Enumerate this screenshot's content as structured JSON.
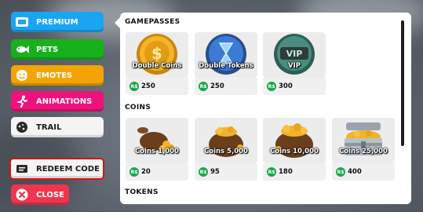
{
  "menu": {
    "premium": "PREMIUM",
    "pets": "PETS",
    "emotes": "EMOTES",
    "animations": "ANIMATIONS",
    "trail": "TRAIL",
    "redeem": "REDEEM CODE",
    "close": "CLOSE"
  },
  "colors": {
    "premium": "#1aa5f2",
    "pets": "#17b21b",
    "emotes": "#f4a400",
    "animations": "#f0127b",
    "close": "#f0354f",
    "highlight": "#e01010",
    "robux": "#18a84a"
  },
  "sections": {
    "gamepasses": "GAMEPASSES",
    "coins": "COINS",
    "tokens": "TOKENS"
  },
  "gamepasses": [
    {
      "name": "Double Coins",
      "price": "250",
      "icon": "coin-icon"
    },
    {
      "name": "Double Tokens",
      "price": "250",
      "icon": "hourglass-icon"
    },
    {
      "name": "VIP",
      "price": "300",
      "icon": "vip-icon"
    }
  ],
  "coins": [
    {
      "name": "Coins 1,000",
      "price": "20",
      "icon": "coin-bag-small-icon"
    },
    {
      "name": "Coins 5,000",
      "price": "95",
      "icon": "coin-bag-icon"
    },
    {
      "name": "Coins 10,000",
      "price": "180",
      "icon": "coin-bag-large-icon"
    },
    {
      "name": "Coins 25,000",
      "price": "400",
      "icon": "treasure-chest-icon"
    }
  ],
  "currency_symbol": "R$"
}
